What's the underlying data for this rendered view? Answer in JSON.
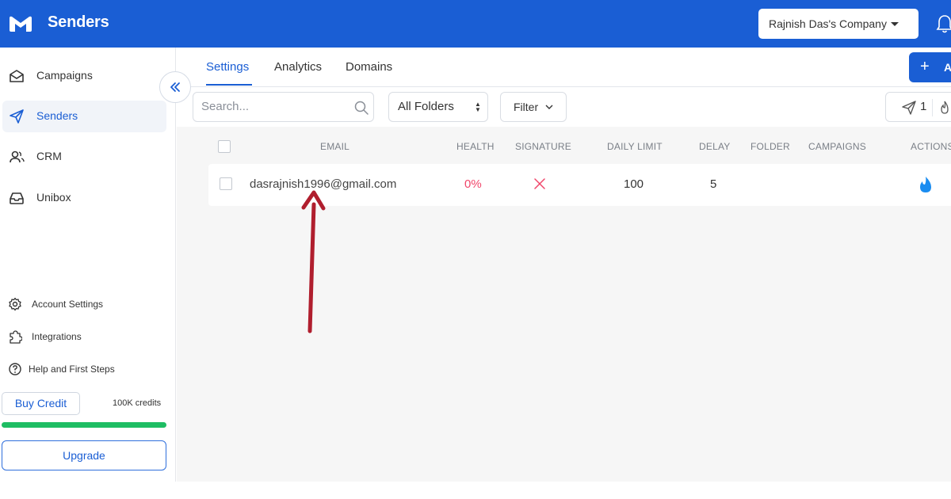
{
  "header": {
    "app_title": "Senders",
    "company": "Rajnish Das's Company",
    "brand_color": "#1a5ed4",
    "icons": [
      "logo-icon",
      "bell-icon",
      "caret-down-icon"
    ]
  },
  "sidebar": {
    "items": [
      {
        "label": "Campaigns",
        "icon": "envelope-icon",
        "active": false
      },
      {
        "label": "Senders",
        "icon": "paper-plane-icon",
        "active": true
      },
      {
        "label": "CRM",
        "icon": "users-icon",
        "active": false
      },
      {
        "label": "Unibox",
        "icon": "inbox-icon",
        "active": false
      }
    ],
    "bottom_items": [
      {
        "label": "Account Settings",
        "icon": "gear-icon"
      },
      {
        "label": "Integrations",
        "icon": "puzzle-icon"
      },
      {
        "label": "Help and First Steps",
        "icon": "help-circle-icon"
      }
    ],
    "buy_credit_label": "Buy Credit",
    "credits_text": "100K credits",
    "credits_fill_fraction": 1.0,
    "credit_bar_color": "#1ebd63",
    "upgrade_label": "Upgrade"
  },
  "main": {
    "tabs": [
      {
        "label": "Settings",
        "active": true
      },
      {
        "label": "Analytics",
        "active": false
      },
      {
        "label": "Domains",
        "active": false
      }
    ],
    "add_button_label": "A",
    "search": {
      "placeholder": "Search...",
      "value": ""
    },
    "folder_select": "All Folders",
    "filter_label": "Filter",
    "sent_count": "1",
    "table": {
      "columns": [
        "EMAIL",
        "HEALTH",
        "SIGNATURE",
        "DAILY LIMIT",
        "DELAY",
        "FOLDER",
        "CAMPAIGNS",
        "ACTIONS"
      ],
      "rows": [
        {
          "email": "dasrajnish1996@gmail.com",
          "health": "0%",
          "signature": "x-icon",
          "daily_limit": "100",
          "delay": "5",
          "folder": "",
          "campaigns": "",
          "actions": "flame-icon"
        }
      ]
    },
    "health_color": "#f0466a",
    "annotation_arrow_color": "#b01e2e"
  }
}
